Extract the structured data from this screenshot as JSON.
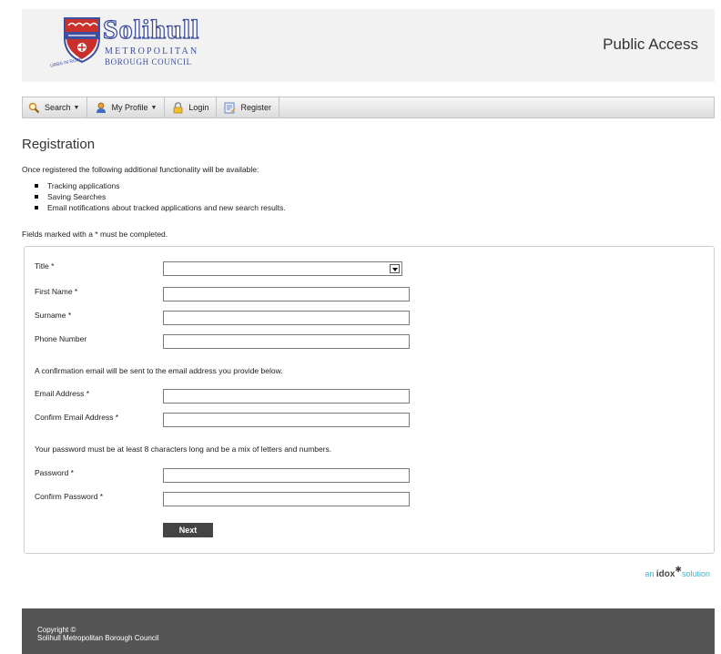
{
  "header": {
    "logo_name": "Solihull",
    "logo_sub1": "METROPOLITAN",
    "logo_sub2": "BOROUGH COUNCIL",
    "logo_motto": "URBS IN RURE",
    "title": "Public Access"
  },
  "nav": {
    "search": "Search",
    "my_profile": "My Profile",
    "login": "Login",
    "register": "Register"
  },
  "page": {
    "title": "Registration",
    "intro": "Once registered the following additional functionality will be available:",
    "features": [
      "Tracking applications",
      "Saving Searches",
      "Email notifications about tracked applications and new search results."
    ],
    "required_note": "Fields marked with a * must be completed."
  },
  "form": {
    "title_label": "Title *",
    "title_value": "",
    "first_name_label": "First Name *",
    "first_name_value": "",
    "surname_label": "Surname *",
    "surname_value": "",
    "phone_label": "Phone Number",
    "phone_value": "",
    "email_note": "A confirmation email will be sent to the email address you provide below.",
    "email_label": "Email Address *",
    "email_value": "",
    "confirm_email_label": "Confirm Email Address *",
    "confirm_email_value": "",
    "password_note": "Your password must be at least 8 characters long and be a mix of letters and numbers.",
    "password_label": "Password *",
    "confirm_password_label": "Confirm Password *",
    "next_label": "Next"
  },
  "branding": {
    "idox_prefix": "an",
    "idox_brand": "idox",
    "idox_suffix": "solution"
  },
  "footer": {
    "line1": "Copyright ©",
    "line2": "Solihull Metropolitan Borough Council"
  },
  "colors": {
    "brand_blue": "#3d4f9e",
    "footer_bg": "#555555",
    "button_bg": "#444444",
    "idox_accent": "#4ab1c9"
  }
}
